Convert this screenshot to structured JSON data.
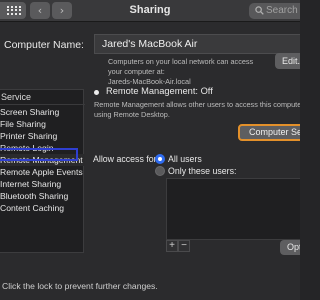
{
  "window": {
    "title": "Sharing",
    "nav_back": "‹",
    "nav_forward": "›",
    "search_placeholder": "Search"
  },
  "computer_name": {
    "label": "Computer Name:",
    "value": "Jared's MacBook Air",
    "description_line1": "Computers on your local network can access your computer at:",
    "description_line2": "Jareds-MacBook-Air.local",
    "edit_button": "Edit..."
  },
  "services": {
    "header": "Service",
    "items": [
      {
        "label": "Screen Sharing"
      },
      {
        "label": "File Sharing"
      },
      {
        "label": "Printer Sharing"
      },
      {
        "label": "Remote Login"
      },
      {
        "label": "Remote Management",
        "selected": true
      },
      {
        "label": "Remote Apple Events"
      },
      {
        "label": "Internet Sharing"
      },
      {
        "label": "Bluetooth Sharing"
      },
      {
        "label": "Content Caching"
      }
    ]
  },
  "remote_management": {
    "status": "Remote Management: Off",
    "description": "Remote Management allows other users to access this computer using Remote Desktop.",
    "computer_settings_button": "Computer Settings...",
    "allow_access_label": "Allow access for:",
    "option_all_users": "All users",
    "option_only_these_users": "Only these users:",
    "selected_option": "All users",
    "add_button": "+",
    "remove_button": "−",
    "options_button": "Options..."
  },
  "footer": {
    "lock_text": "Click the lock to prevent further changes."
  },
  "colors": {
    "highlight_service": "#2f3fd0",
    "highlight_button": "#e3902a",
    "radio_selected": "#2f6cf0"
  }
}
